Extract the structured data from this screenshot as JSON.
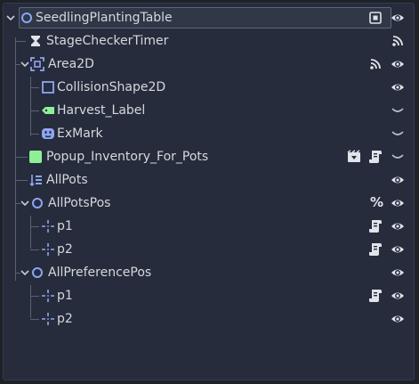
{
  "tree": {
    "root": {
      "label": "SeedlingPlantingTable"
    },
    "nodes": [
      {
        "label": "StageCheckerTimer"
      },
      {
        "label": "Area2D"
      },
      {
        "label": "CollisionShape2D"
      },
      {
        "label": "Harvest_Label"
      },
      {
        "label": "ExMark"
      },
      {
        "label": "Popup_Inventory_For_Pots"
      },
      {
        "label": "AllPots"
      },
      {
        "label": "AllPotsPos"
      },
      {
        "label": "p1"
      },
      {
        "label": "p2"
      },
      {
        "label": "AllPreferencePos"
      },
      {
        "label": "p1"
      },
      {
        "label": "p2"
      }
    ],
    "all_pots_pos_badge": "%"
  },
  "colors": {
    "background": "#262c3b",
    "node2d_blue": "#8da5f3",
    "control_green": "#8eef97",
    "text": "#d4d8de"
  }
}
